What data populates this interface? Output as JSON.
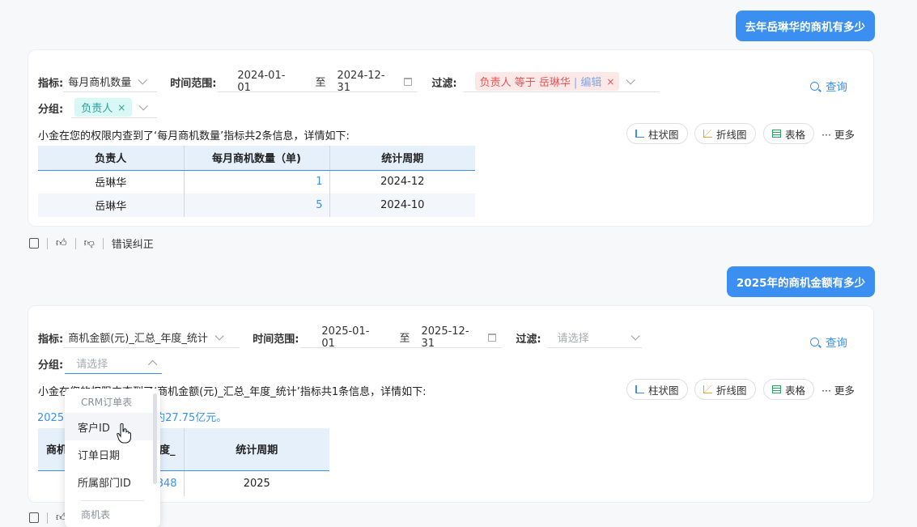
{
  "messages": [
    {
      "question": "去年岳琳华的商机有多少",
      "filters": {
        "metric_label": "指标:",
        "metric_value": "每月商机数量",
        "time_label": "时间范围:",
        "start_date": "2024-01-01",
        "to": "至",
        "end_date": "2024-12-31",
        "filter_label": "过滤:",
        "filter_tag": "负责人 等于 岳琳华",
        "filter_edit": "| 编辑",
        "group_label": "分组:",
        "group_tag": "负责人",
        "query": "查询"
      },
      "info": "小金在您的权限内查到了‘每月商机数量’指标共2条信息，详情如下:",
      "toolbar": {
        "bar": "柱状图",
        "line": "折线图",
        "table": "表格",
        "more": "··· 更多"
      },
      "table": {
        "headers": [
          "负责人",
          "每月商机数量（单)",
          "统计周期"
        ],
        "rows": [
          [
            "岳琳华",
            "1",
            "2024-12"
          ],
          [
            "岳琳华",
            "5",
            "2024-10"
          ]
        ]
      },
      "actions": {
        "correct": "错误纠正"
      }
    },
    {
      "question": "2025年的商机金额有多少",
      "filters": {
        "metric_label": "指标:",
        "metric_value": "商机金额(元)_汇总_年度_统计",
        "time_label": "时间范围:",
        "start_date": "2025-01-01",
        "to": "至",
        "end_date": "2025-12-31",
        "filter_label": "过滤:",
        "filter_placeholder": "请选择",
        "group_label": "分组:",
        "group_placeholder": "请选择",
        "query": "查询"
      },
      "info": "小金在您的权限内查到了‘商机金额(元)_汇总_年度_统计’指标共1条信息，详情如下:",
      "toolbar": {
        "bar": "柱状图",
        "line": "折线图",
        "table": "表格",
        "more": "··· 更多"
      },
      "summary": "2025",
      "summary_tail": "约27.75亿元。",
      "table": {
        "headers": [
          "商机",
          "度_",
          "统计周期"
        ],
        "rows": [
          [
            "",
            "848",
            "2025"
          ]
        ]
      }
    }
  ],
  "dropdown": {
    "group": "CRM订单表",
    "items": [
      "客户ID",
      "订单日期",
      "所属部门ID"
    ],
    "next_group": "商机表"
  }
}
